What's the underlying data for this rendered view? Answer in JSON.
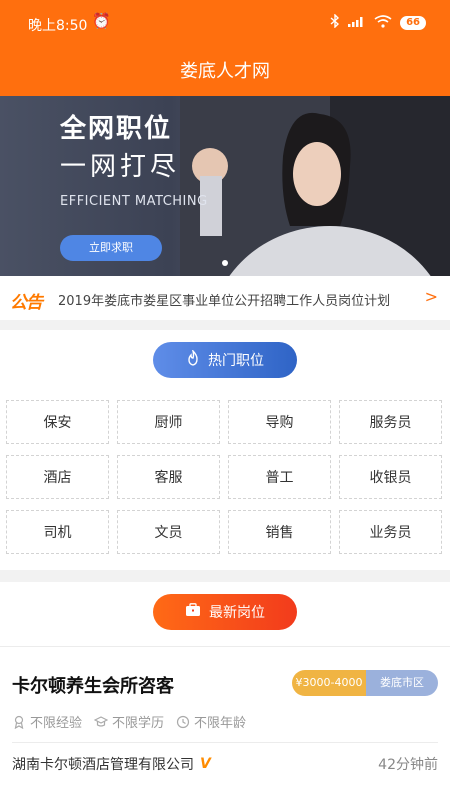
{
  "status_bar": {
    "time": "晚上8:50",
    "battery": "66"
  },
  "header": {
    "title": "娄底人才网"
  },
  "banner": {
    "line1": "全网职位",
    "line2": "一网打尽",
    "line3": "EFFICIENT MATCHING",
    "cta": "立即求职"
  },
  "notice": {
    "logo": "公告",
    "text": "2019年娄底市娄星区事业单位公开招聘工作人员岗位计划",
    "arrow": ">"
  },
  "hot_jobs": {
    "label": "热门职位",
    "items": [
      "保安",
      "厨师",
      "导购",
      "服务员",
      "酒店",
      "客服",
      "普工",
      "收银员",
      "司机",
      "文员",
      "销售",
      "业务员"
    ]
  },
  "latest": {
    "label": "最新岗位",
    "jobs": [
      {
        "title": "卡尔顿养生会所咨客",
        "salary": "¥3000-4000",
        "location": "娄底市区",
        "experience": "不限经验",
        "education": "不限学历",
        "age": "不限年龄",
        "company": "湖南卡尔顿酒店管理有限公司",
        "posted": "42分钟前"
      }
    ]
  },
  "colors": {
    "brand": "#ff6f0e",
    "hot_pill": "#2f64c6",
    "latest_pill": "#f23b1c",
    "salary": "#f0b443",
    "location": "#9bb1dc"
  }
}
